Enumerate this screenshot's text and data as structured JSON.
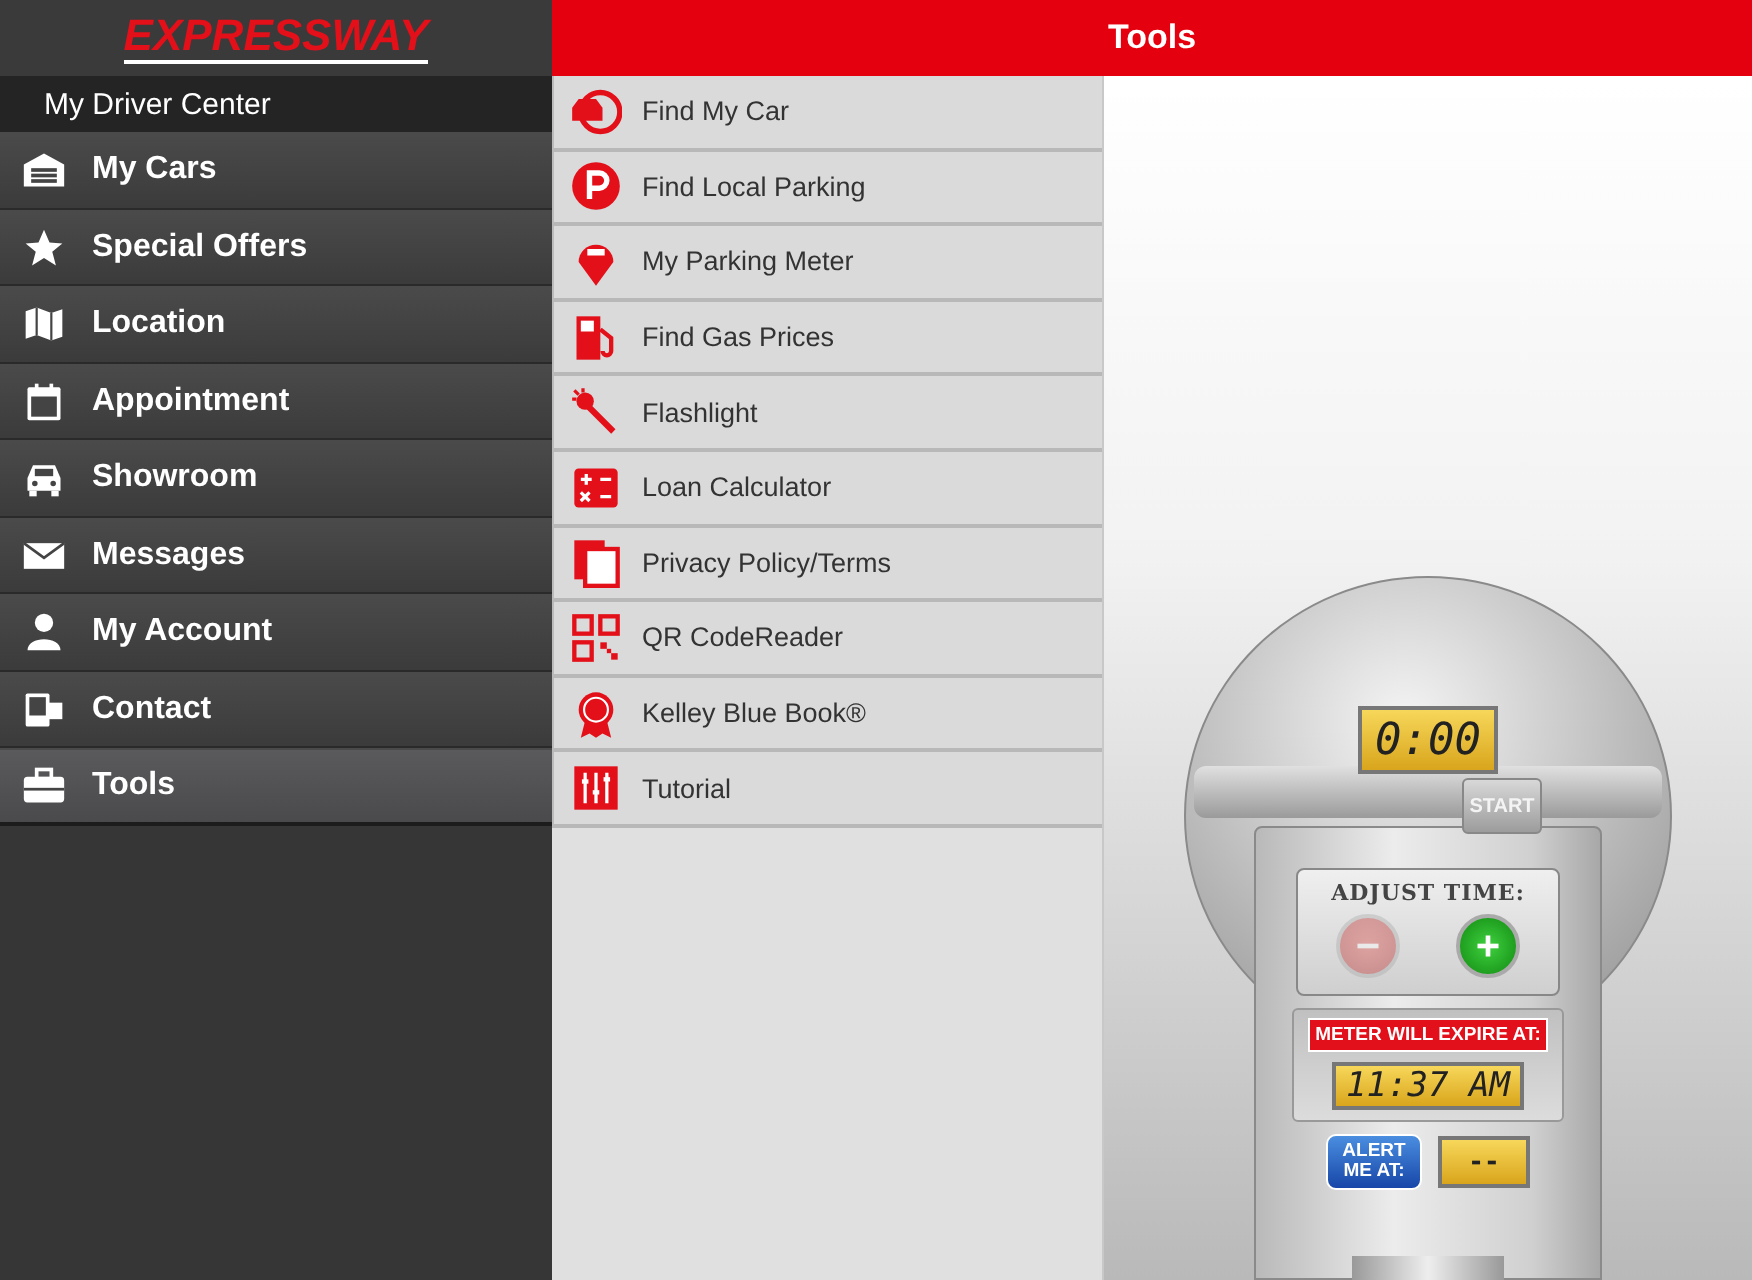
{
  "logo": {
    "text": "EXPRESSWAY"
  },
  "sidebar": {
    "heading": "My Driver Center",
    "items": [
      {
        "label": "My Cars",
        "selected": false
      },
      {
        "label": "Special Offers",
        "selected": false
      },
      {
        "label": "Location",
        "selected": false
      },
      {
        "label": "Appointment",
        "selected": false
      },
      {
        "label": "Showroom",
        "selected": false
      },
      {
        "label": "Messages",
        "selected": false
      },
      {
        "label": "My Account",
        "selected": false
      },
      {
        "label": "Contact",
        "selected": false
      },
      {
        "label": "Tools",
        "selected": true
      }
    ]
  },
  "header": {
    "title": "Tools"
  },
  "tools": [
    {
      "label": "Find My Car"
    },
    {
      "label": "Find Local Parking"
    },
    {
      "label": "My Parking Meter"
    },
    {
      "label": "Find Gas Prices"
    },
    {
      "label": "Flashlight"
    },
    {
      "label": "Loan Calculator"
    },
    {
      "label": "Privacy Policy/Terms"
    },
    {
      "label": "QR CodeReader"
    },
    {
      "label": "Kelley Blue Book®"
    },
    {
      "label": "Tutorial"
    }
  ],
  "meter": {
    "time_display": "0:00",
    "start_label": "START",
    "adjust_label": "ADJUST TIME:",
    "minus_disabled": true,
    "plus_disabled": false,
    "expire_label": "METER WILL EXPIRE AT:",
    "expire_time": "11:37 AM",
    "alert_label": "ALERT ME AT:",
    "alert_time": "--"
  }
}
